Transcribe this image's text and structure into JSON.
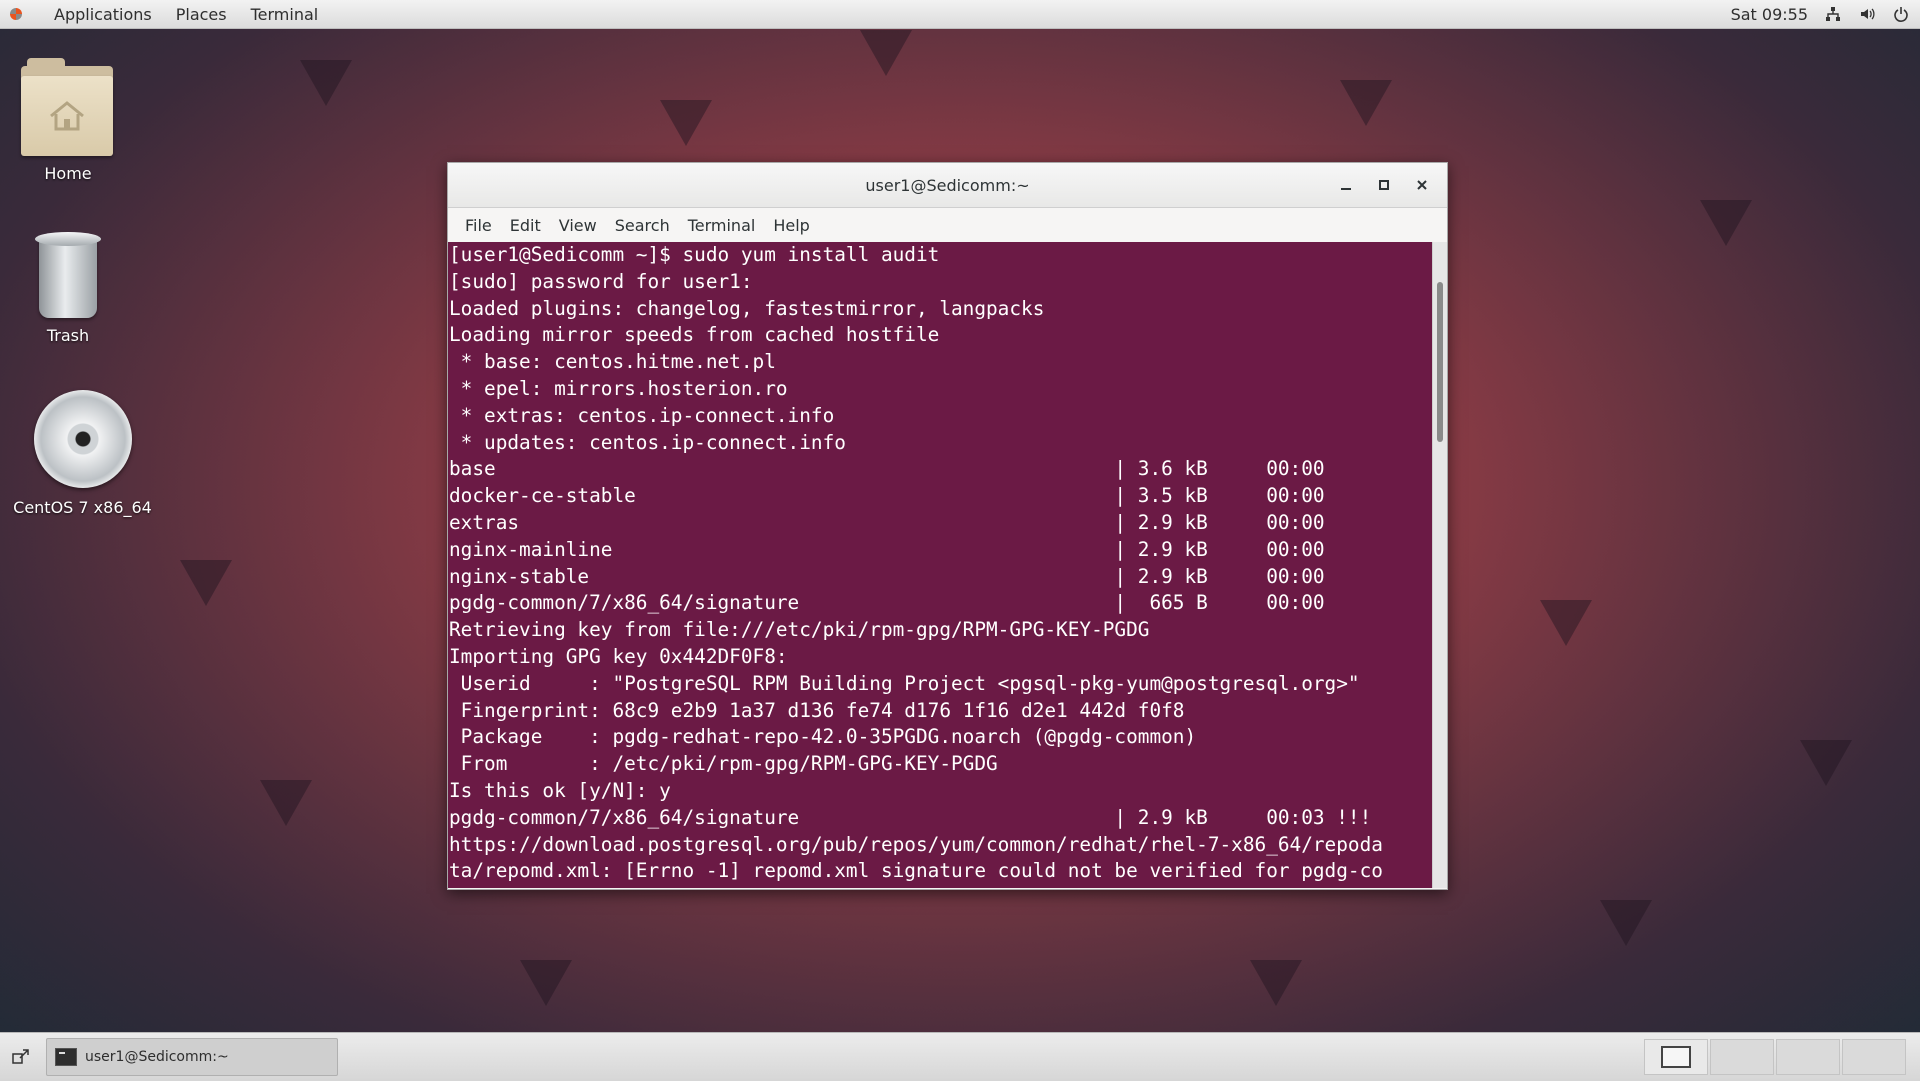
{
  "topbar": {
    "applications": "Applications",
    "places": "Places",
    "terminal": "Terminal",
    "clock": "Sat 09:55"
  },
  "desktop": {
    "home_label": "Home",
    "trash_label": "Trash",
    "disc_label": "CentOS 7 x86_64"
  },
  "window": {
    "title": "user1@Sedicomm:~",
    "menu": [
      "File",
      "Edit",
      "View",
      "Search",
      "Terminal",
      "Help"
    ]
  },
  "terminal_lines": [
    "[user1@Sedicomm ~]$ sudo yum install audit",
    "[sudo] password for user1:",
    "Loaded plugins: changelog, fastestmirror, langpacks",
    "Loading mirror speeds from cached hostfile",
    " * base: centos.hitme.net.pl",
    " * epel: mirrors.hosterion.ro",
    " * extras: centos.ip-connect.info",
    " * updates: centos.ip-connect.info",
    "base                                                     | 3.6 kB     00:00",
    "docker-ce-stable                                         | 3.5 kB     00:00",
    "extras                                                   | 2.9 kB     00:00",
    "nginx-mainline                                           | 2.9 kB     00:00",
    "nginx-stable                                             | 2.9 kB     00:00",
    "pgdg-common/7/x86_64/signature                           |  665 B     00:00",
    "Retrieving key from file:///etc/pki/rpm-gpg/RPM-GPG-KEY-PGDG",
    "Importing GPG key 0x442DF0F8:",
    " Userid     : \"PostgreSQL RPM Building Project <pgsql-pkg-yum@postgresql.org>\"",
    " Fingerprint: 68c9 e2b9 1a37 d136 fe74 d176 1f16 d2e1 442d f0f8",
    " Package    : pgdg-redhat-repo-42.0-35PGDG.noarch (@pgdg-common)",
    " From       : /etc/pki/rpm-gpg/RPM-GPG-KEY-PGDG",
    "Is this ok [y/N]: y",
    "pgdg-common/7/x86_64/signature                           | 2.9 kB     00:03 !!!",
    "https://download.postgresql.org/pub/repos/yum/common/redhat/rhel-7-x86_64/repoda",
    "ta/repomd.xml: [Errno -1] repomd.xml signature could not be verified for pgdg-co"
  ],
  "taskbar": {
    "window_label": "user1@Sedicomm:~"
  },
  "colors": {
    "terminal_bg": "#6b1a45",
    "terminal_fg": "#ffffff"
  }
}
